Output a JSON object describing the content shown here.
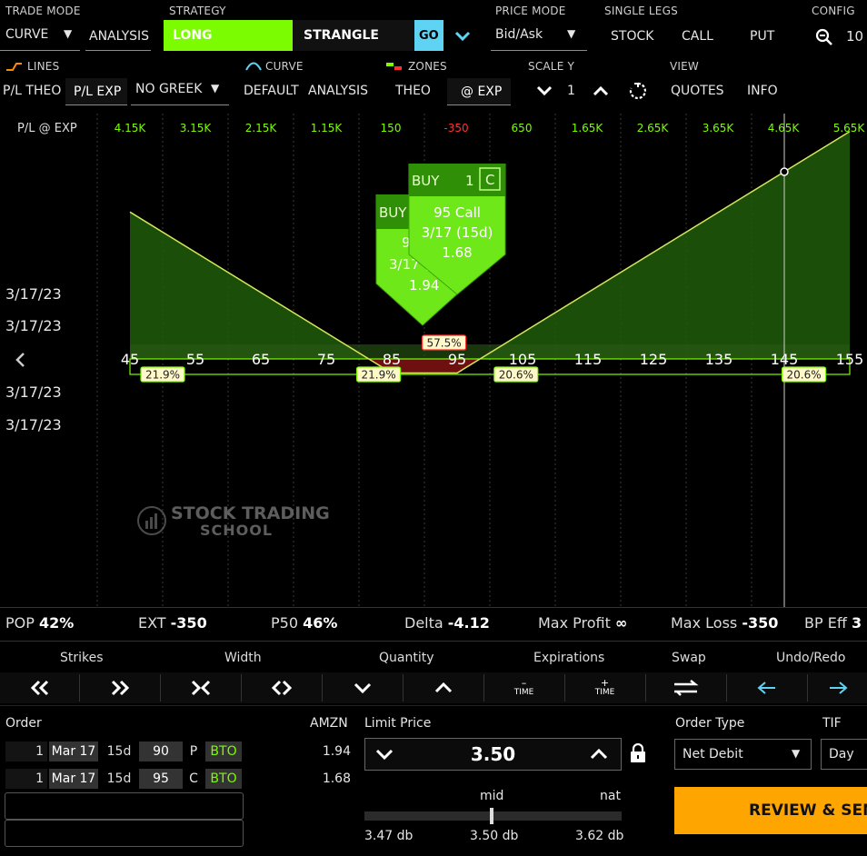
{
  "header": {
    "trade_mode_label": "TRADE MODE",
    "trade_mode_value": "CURVE",
    "analysis_label": "ANALYSIS",
    "strategy_label": "STRATEGY",
    "long_label": "LONG",
    "strategy_value": "STRANGLE",
    "go_label": "GO",
    "price_mode_label": "PRICE MODE",
    "price_mode_value": "Bid/Ask",
    "single_legs_label": "SINGLE LEGS",
    "stock_label": "STOCK",
    "call_label": "CALL",
    "put_label": "PUT",
    "config_label": "CONFIG",
    "zoom_value": "10"
  },
  "toolbar2": {
    "lines_label": "LINES",
    "curve_label": "CURVE",
    "zones_label": "ZONES",
    "scale_y_label": "SCALE Y",
    "view_label": "VIEW",
    "pl_theo": "P/L THEO",
    "pl_exp": "P/L EXP",
    "greek_value": "NO GREEK",
    "default_label": "DEFAULT",
    "analysis_label": "ANALYSIS",
    "theo_label": "THEO",
    "at_exp_label": "@ EXP",
    "scale_value": "1",
    "quotes_label": "QUOTES",
    "info_label": "INFO"
  },
  "pl_row": {
    "label": "P/L @ EXP",
    "values": [
      {
        "text": "4.15K",
        "sign": "pos"
      },
      {
        "text": "3.15K",
        "sign": "pos"
      },
      {
        "text": "2.15K",
        "sign": "pos"
      },
      {
        "text": "1.15K",
        "sign": "pos"
      },
      {
        "text": "150",
        "sign": "pos"
      },
      {
        "text": "-350",
        "sign": "neg"
      },
      {
        "text": "650",
        "sign": "pos"
      },
      {
        "text": "1.65K",
        "sign": "pos"
      },
      {
        "text": "2.65K",
        "sign": "pos"
      },
      {
        "text": "3.65K",
        "sign": "pos"
      },
      {
        "text": "4.65K",
        "sign": "pos"
      },
      {
        "text": "5.65K",
        "sign": "pos"
      }
    ]
  },
  "chart_data": {
    "type": "line",
    "strikes": [
      "45",
      "55",
      "65",
      "75",
      "85",
      "95",
      "105",
      "115",
      "125",
      "135",
      "145",
      "155"
    ],
    "payoff_x": [
      45,
      85,
      95,
      155
    ],
    "payoff_y": [
      3650,
      -350,
      -350,
      5650
    ],
    "zones": [
      {
        "label": "21.9%",
        "at": 50
      },
      {
        "label": "21.9%",
        "at": 83
      },
      {
        "label": "57.5%",
        "at": 93
      },
      {
        "label": "20.6%",
        "at": 104
      },
      {
        "label": "20.6%",
        "at": 148
      }
    ],
    "date_labels": [
      "3/17/23",
      "3/17/23",
      "3/17/23",
      "3/17/23"
    ],
    "legs": [
      {
        "action": "BUY",
        "qty": "1",
        "type_badge": "C",
        "title": "95 Call",
        "expiry": "3/17 (15d)",
        "price": "1.68"
      },
      {
        "action": "BUY",
        "qty": "",
        "type_badge": "",
        "title": "90 Put",
        "expiry": "3/17 (15d)",
        "price": "1.94"
      }
    ],
    "marker_strike": 145
  },
  "watermark": {
    "line1": "STOCK TRADING",
    "line2": "SCHOOL"
  },
  "stats": {
    "pop_label": "POP",
    "pop_value": "42%",
    "ext_label": "EXT",
    "ext_value": "-350",
    "p50_label": "P50",
    "p50_value": "46%",
    "delta_label": "Delta",
    "delta_value": "-4.12",
    "maxprofit_label": "Max Profit",
    "maxprofit_value": "∞",
    "maxloss_label": "Max Loss",
    "maxloss_value": "-350",
    "bpeff_label": "BP Eff",
    "bpeff_value": "3"
  },
  "tools": {
    "strikes": "Strikes",
    "width": "Width",
    "quantity": "Quantity",
    "expirations": "Expirations",
    "swap": "Swap",
    "undo_redo": "Undo/Redo",
    "time_minus": "TIME",
    "time_plus": "TIME"
  },
  "order": {
    "order_label": "Order",
    "symbol": "AMZN",
    "legs": [
      {
        "qty": "1",
        "exp": "Mar 17",
        "days": "15d",
        "strike": "90",
        "type": "P",
        "side": "BTO",
        "price": "1.94"
      },
      {
        "qty": "1",
        "exp": "Mar 17",
        "days": "15d",
        "strike": "95",
        "type": "C",
        "side": "BTO",
        "price": "1.68"
      }
    ],
    "limit_label": "Limit Price",
    "limit_value": "3.50",
    "mid_label": "mid",
    "nat_label": "nat",
    "low_db": "3.47 db",
    "mid_db": "3.50 db",
    "nat_db": "3.62 db",
    "order_type_label": "Order Type",
    "order_type_value": "Net Debit",
    "tif_label": "TIF",
    "tif_value": "Day",
    "review_label": "REVIEW & SEN"
  },
  "colors": {
    "accent_green": "#7CFC00",
    "loss_red": "#ff3030",
    "review_orange": "#FFA500",
    "go_blue": "#5fd3f3"
  }
}
